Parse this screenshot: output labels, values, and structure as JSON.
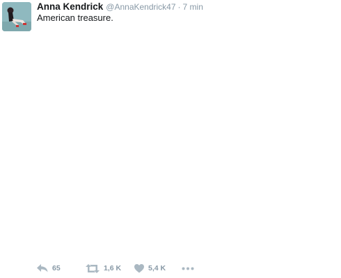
{
  "tweet": {
    "author_name": "Anna Kendrick",
    "handle": "@AnnaKendrick47",
    "separator": "·",
    "time": "7 min",
    "text": "American treasure."
  },
  "actions": {
    "reply_count": "65",
    "retweet_count": "1,6 K",
    "like_count": "5,4 K"
  },
  "icons": {
    "reply": "reply-icon",
    "retweet": "retweet-icon",
    "like": "heart-icon",
    "more": "more-dots-icon"
  },
  "colors": {
    "name": "#14171a",
    "muted": "#8899a6",
    "icon": "#aab8c2",
    "avatar_bg": "#8fb9bf"
  }
}
